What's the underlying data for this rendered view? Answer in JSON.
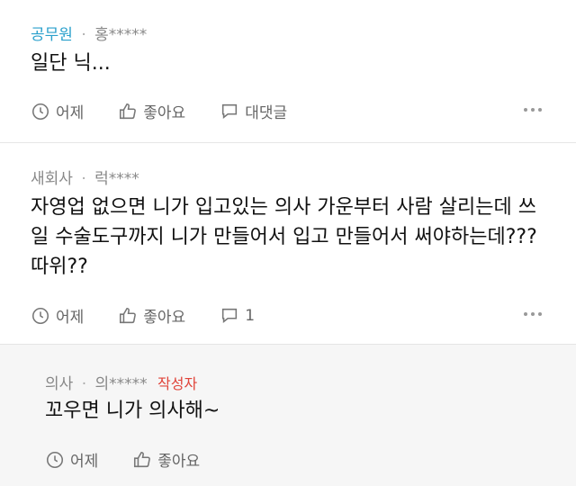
{
  "comments": [
    {
      "author": "공무원",
      "separator": "·",
      "user_id": "홍*****",
      "text": [
        "일단 닉..."
      ],
      "time": "어제",
      "like_label": "좋아요",
      "reply_label": "대댓글"
    },
    {
      "author": "새회사",
      "separator": "·",
      "user_id": "럭****",
      "text": [
        "자영업 없으면 니가 입고있는 의사 가운부터 사람 살리는데 쓰",
        "일 수술도구까지 니가 만들어서 입고 만들어서 써야하는데???",
        "따위??"
      ],
      "time": "어제",
      "like_label": "좋아요",
      "reply_count": "1"
    },
    {
      "author": "의사",
      "separator": "·",
      "user_id": "의*****",
      "writer_tag": "작성자",
      "text": [
        "꼬우면 니가 의사해~"
      ],
      "time": "어제",
      "like_label": "좋아요"
    }
  ],
  "icons": {
    "clock": "clock-icon",
    "like": "thumbs-up-icon",
    "reply": "speech-bubble-icon",
    "more": "more-dots-icon"
  },
  "colors": {
    "accent_author": "#2aa0cc",
    "writer_tag": "#e0443a",
    "reply_bg": "#f6f6f6"
  }
}
